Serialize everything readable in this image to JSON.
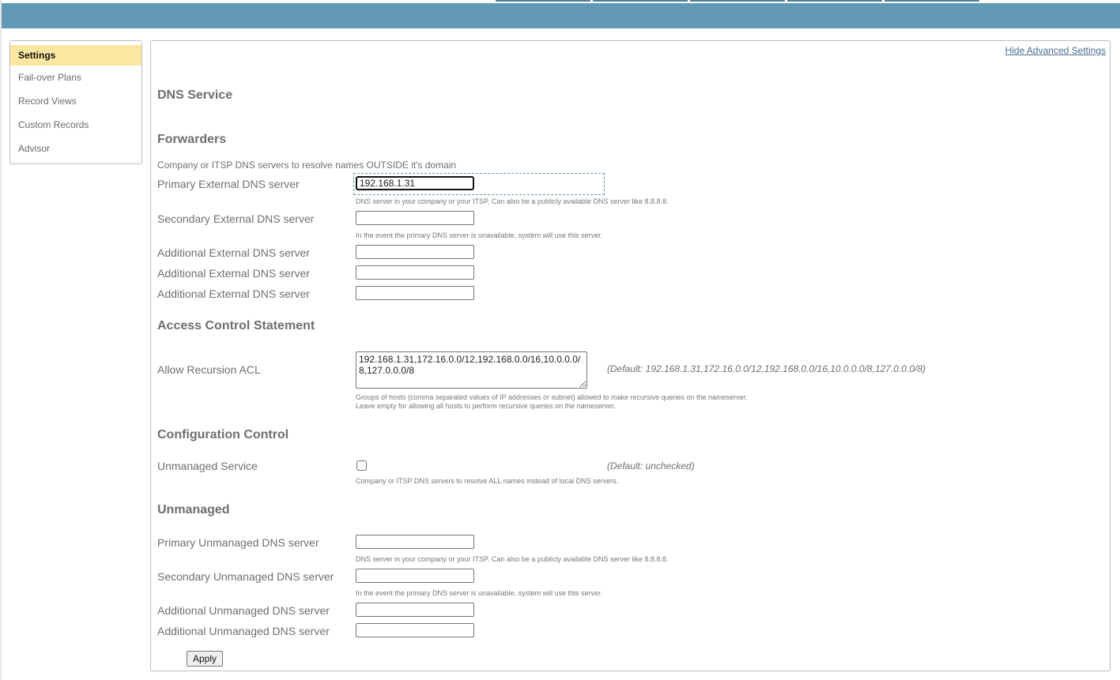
{
  "header": {
    "top_tabs_count": 5,
    "color": "#6299b5"
  },
  "sidebar": {
    "items": [
      {
        "label": "Settings",
        "active": true
      },
      {
        "label": "Fail-over Plans",
        "active": false
      },
      {
        "label": "Record Views",
        "active": false
      },
      {
        "label": "Custom Records",
        "active": false
      },
      {
        "label": "Advisor",
        "active": false
      }
    ]
  },
  "panel": {
    "hide_advanced_link": "Hide Advanced Settings",
    "page_title": "DNS Service",
    "forwarders": {
      "title": "Forwarders",
      "intro": "Company or ITSP DNS servers to resolve names OUTSIDE it's domain",
      "primary_label": "Primary External DNS server",
      "primary_value": "192.168.1.31",
      "primary_help": "DNS server in your company or your ITSP. Can also be a publicly available DNS server like 8.8.8.8.",
      "secondary_label": "Secondary External DNS server",
      "secondary_value": "",
      "secondary_help": "In the event the primary DNS server is unavailable, system will use this server.",
      "additional_label_1": "Additional External DNS server",
      "additional_label_2": "Additional External DNS server",
      "additional_label_3": "Additional External DNS server"
    },
    "acl": {
      "title": "Access Control Statement",
      "label": "Allow Recursion ACL",
      "value": "192.168.1.31,172.16.0.0/12,192.168.0.0/16,10.0.0.0/8,127.0.0.0/8",
      "default": "(Default: 192.168.1.31,172.16.0.0/12,192.168.0.0/16,10.0.0.0/8,127.0.0.0/8)",
      "help_line_1": "Groups of hosts (comma separated values of IP addresses or subnet) allowed to make recursive queries on the nameserver.",
      "help_line_2": "Leave empty for allowing all hosts to perform recursive queries on the nameserver."
    },
    "config": {
      "title": "Configuration Control",
      "label": "Unmanaged Service",
      "checked": false,
      "default": "(Default: unchecked)",
      "help": "Company or ITSP DNS servers to resolve ALL names instead of local DNS servers."
    },
    "unmanaged": {
      "title": "Unmanaged",
      "primary_label": "Primary Unmanaged DNS server",
      "primary_help": "DNS server in your company or your ITSP. Can also be a publicly available DNS server like 8.8.8.8.",
      "secondary_label": "Secondary Unmanaged DNS server",
      "secondary_help": "In the event the primary DNS server is unavailable, system will use this server.",
      "additional_label_1": "Additional Unmanaged DNS server",
      "additional_label_2": "Additional Unmanaged DNS server"
    },
    "apply_label": "Apply"
  }
}
